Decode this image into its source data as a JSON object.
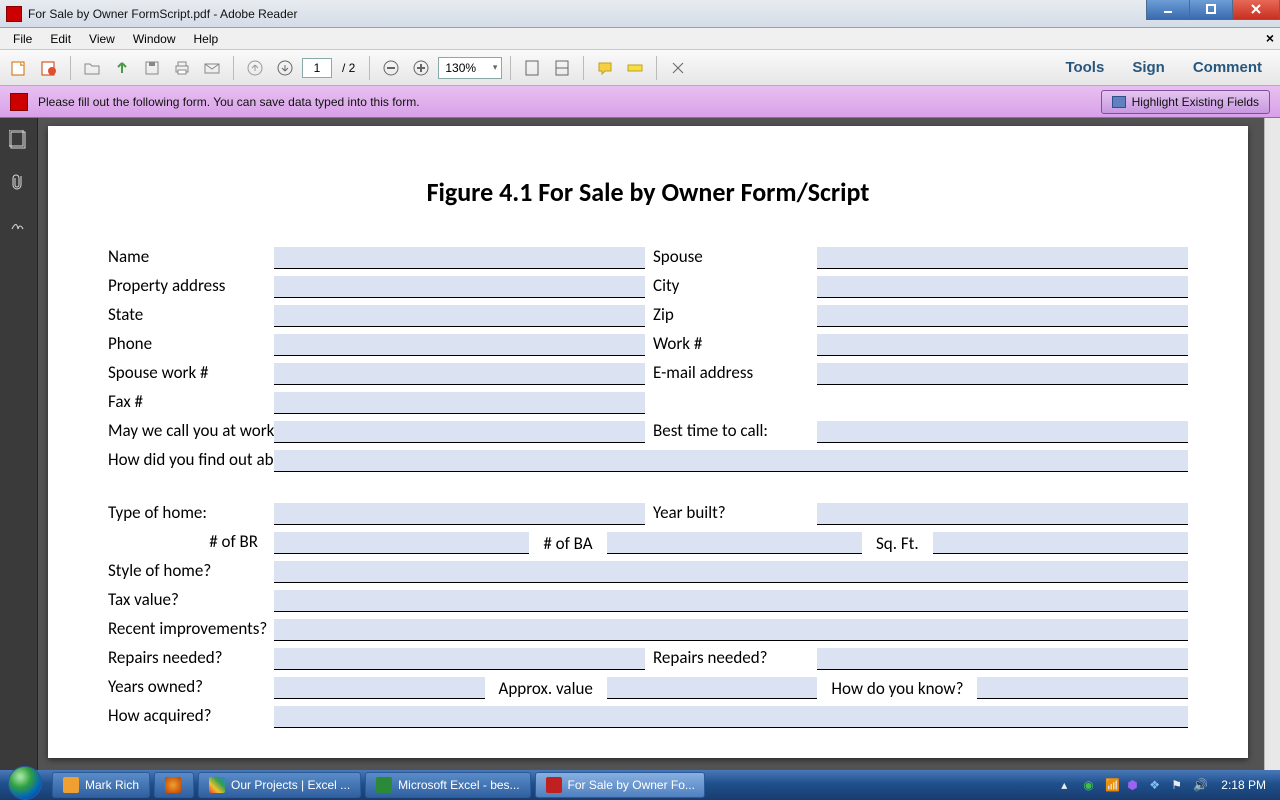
{
  "window": {
    "title": "For Sale by Owner FormScript.pdf - Adobe Reader"
  },
  "menu": {
    "items": [
      "File",
      "Edit",
      "View",
      "Window",
      "Help"
    ]
  },
  "toolbar": {
    "page_current": "1",
    "page_sep": "/ 2",
    "zoom": "130%"
  },
  "panels": {
    "tools": "Tools",
    "sign": "Sign",
    "comment": "Comment"
  },
  "notice": {
    "text": "Please fill out the following form. You can save data typed into this form.",
    "highlight_btn": "Highlight Existing Fields"
  },
  "doc": {
    "title": "Figure 4.1 For Sale by Owner Form/Script",
    "labels": {
      "name": "Name",
      "spouse": "Spouse",
      "property_address": "Property address",
      "city": "City",
      "state": "State",
      "zip": "Zip",
      "phone": "Phone",
      "work_no": "Work #",
      "spouse_work_no": "Spouse work #",
      "email": "E-mail address",
      "fax": "Fax #",
      "may_we_call": "May we call you at work?",
      "best_time": "Best time to call:",
      "how_find": "How did you find out about us?",
      "type_home": "Type of home:",
      "year_built": "Year built?",
      "num_br": "# of BR",
      "num_ba": "# of BA",
      "sqft": "Sq. Ft.",
      "style": "Style of home?",
      "tax_value": "Tax value?",
      "recent_improve": "Recent improvements?",
      "repairs_needed": "Repairs needed?",
      "repairs_needed2": "Repairs needed?",
      "years_owned": "Years owned?",
      "approx_value": "Approx. value",
      "how_know": "How do you know?",
      "how_acquired": "How acquired?"
    }
  },
  "taskbar": {
    "items": [
      "Mark Rich",
      "",
      "Our Projects | Excel ...",
      "Microsoft Excel - bes...",
      "For Sale by Owner Fo..."
    ],
    "clock": "2:18 PM"
  }
}
